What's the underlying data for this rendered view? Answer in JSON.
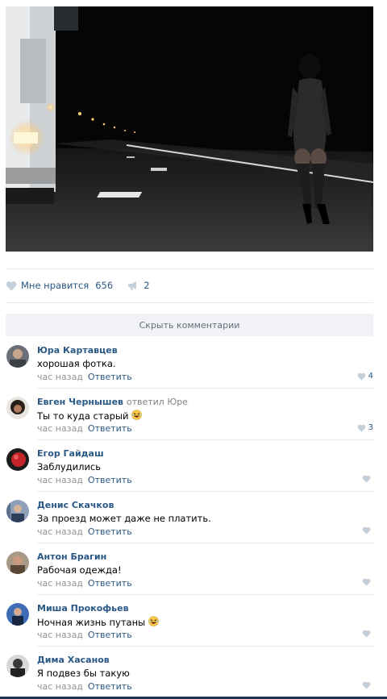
{
  "post": {
    "photo_alt": "night road photo",
    "likes_label": "Мне нравится",
    "likes_count": "656",
    "shares_count": "2"
  },
  "hide_comments_label": "Скрыть комментарии",
  "comments": [
    {
      "author": "Юра Картавцев",
      "replied": "",
      "text": "хорошая фотка.",
      "time": "час назад",
      "reply": "Ответить",
      "likes": "4",
      "emoji": false
    },
    {
      "author": "Евген Чернышев",
      "replied": "ответил Юре",
      "text": "Ты то куда старый",
      "time": "час назад",
      "reply": "Ответить",
      "likes": "3",
      "emoji": true
    },
    {
      "author": "Егор Гайдаш",
      "replied": "",
      "text": "Заблудились",
      "time": "час назад",
      "reply": "Ответить",
      "likes": "",
      "emoji": false
    },
    {
      "author": "Денис Скачков",
      "replied": "",
      "text": "За проезд может даже не платить.",
      "time": "час назад",
      "reply": "Ответить",
      "likes": "",
      "emoji": false
    },
    {
      "author": "Антон Брагин",
      "replied": "",
      "text": "Рабочая одежда!",
      "time": "час назад",
      "reply": "Ответить",
      "likes": "",
      "emoji": false
    },
    {
      "author": "Миша Прокофьев",
      "replied": "",
      "text": "Ночная жизнь путаны",
      "time": "час назад",
      "reply": "Ответить",
      "likes": "",
      "emoji": true
    },
    {
      "author": "Дима Хасанов",
      "replied": "",
      "text": "Я подвез бы такую",
      "time": "час назад",
      "reply": "Ответить",
      "likes": "",
      "emoji": false
    }
  ],
  "colors": {
    "link": "#2a5885",
    "muted": "#939393",
    "bar": "#f0f2f5",
    "heart": "#c5d0db"
  },
  "icons": {
    "like": "heart-icon",
    "share": "megaphone-icon",
    "emoji": "laughing-emoji-icon"
  }
}
